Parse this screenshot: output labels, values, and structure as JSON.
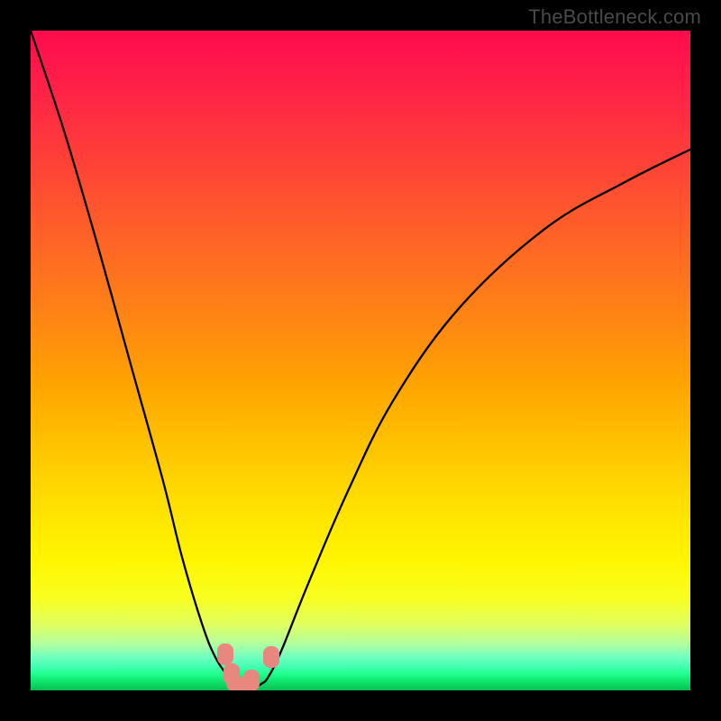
{
  "watermark": "TheBottleneck.com",
  "colors": {
    "frame": "#000000",
    "curve": "#000000",
    "bump": "#e8877e"
  },
  "chart_data": {
    "type": "line",
    "title": "",
    "xlabel": "",
    "ylabel": "",
    "xlim": [
      0,
      100
    ],
    "ylim": [
      0,
      100
    ],
    "grid": false,
    "legend": false,
    "series": [
      {
        "name": "bottleneck-curve",
        "x": [
          0,
          5,
          10,
          15,
          20,
          23,
          26,
          28,
          30,
          31,
          32,
          33,
          34,
          35,
          36,
          38,
          42,
          48,
          55,
          65,
          78,
          90,
          100
        ],
        "y": [
          100,
          85,
          68,
          50,
          32,
          20,
          10,
          5,
          2,
          1,
          0.5,
          0.5,
          0.5,
          1,
          2,
          6,
          16,
          30,
          44,
          58,
          70,
          77,
          82
        ]
      }
    ],
    "annotations": [
      {
        "name": "bump-left-upper",
        "x": 29.5,
        "y": 5.5
      },
      {
        "name": "bump-left-lower",
        "x": 30.5,
        "y": 2.5
      },
      {
        "name": "bump-mid",
        "x": 33.5,
        "y": 1.5
      },
      {
        "name": "bump-right",
        "x": 36.5,
        "y": 5.0
      }
    ],
    "gradient_stops": [
      {
        "pos": 0.0,
        "color": "#ff0b4d"
      },
      {
        "pos": 0.25,
        "color": "#ff5030"
      },
      {
        "pos": 0.54,
        "color": "#ffa500"
      },
      {
        "pos": 0.8,
        "color": "#fff500"
      },
      {
        "pos": 0.95,
        "color": "#70ffc0"
      },
      {
        "pos": 1.0,
        "color": "#08c050"
      }
    ]
  }
}
